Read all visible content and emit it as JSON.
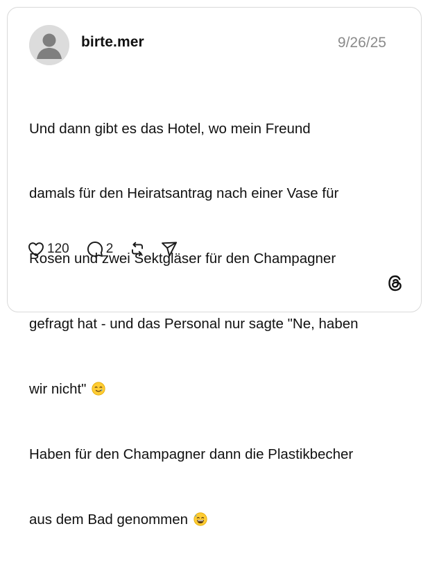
{
  "post": {
    "username": "birte.mer",
    "date": "9/26/25",
    "lines": [
      "Und dann gibt es das Hotel, wo mein Freund",
      "damals für den Heiratsantrag nach einer Vase für",
      "Rosen und zwei Sektgläser für den Champagner",
      "gefragt hat - und das Personal nur sagte \"Ne, haben",
      "wir nicht\"",
      "Haben für den Champagner dann die Plastikbecher",
      "aus dem Bad genommen"
    ],
    "emojis": [
      "smiling-face-with-tear",
      "grinning-face-with-sweat"
    ]
  },
  "actions": {
    "likes": "120",
    "replies": "2"
  },
  "icons": {
    "like": "heart-icon",
    "reply": "speech-bubble-icon",
    "repost": "repost-icon",
    "share": "send-icon",
    "brand": "threads-logo-icon"
  },
  "colors": {
    "border": "#d9d9d9",
    "text": "#111111",
    "muted": "#8a8a8a",
    "emoji": "#ffcc33"
  }
}
